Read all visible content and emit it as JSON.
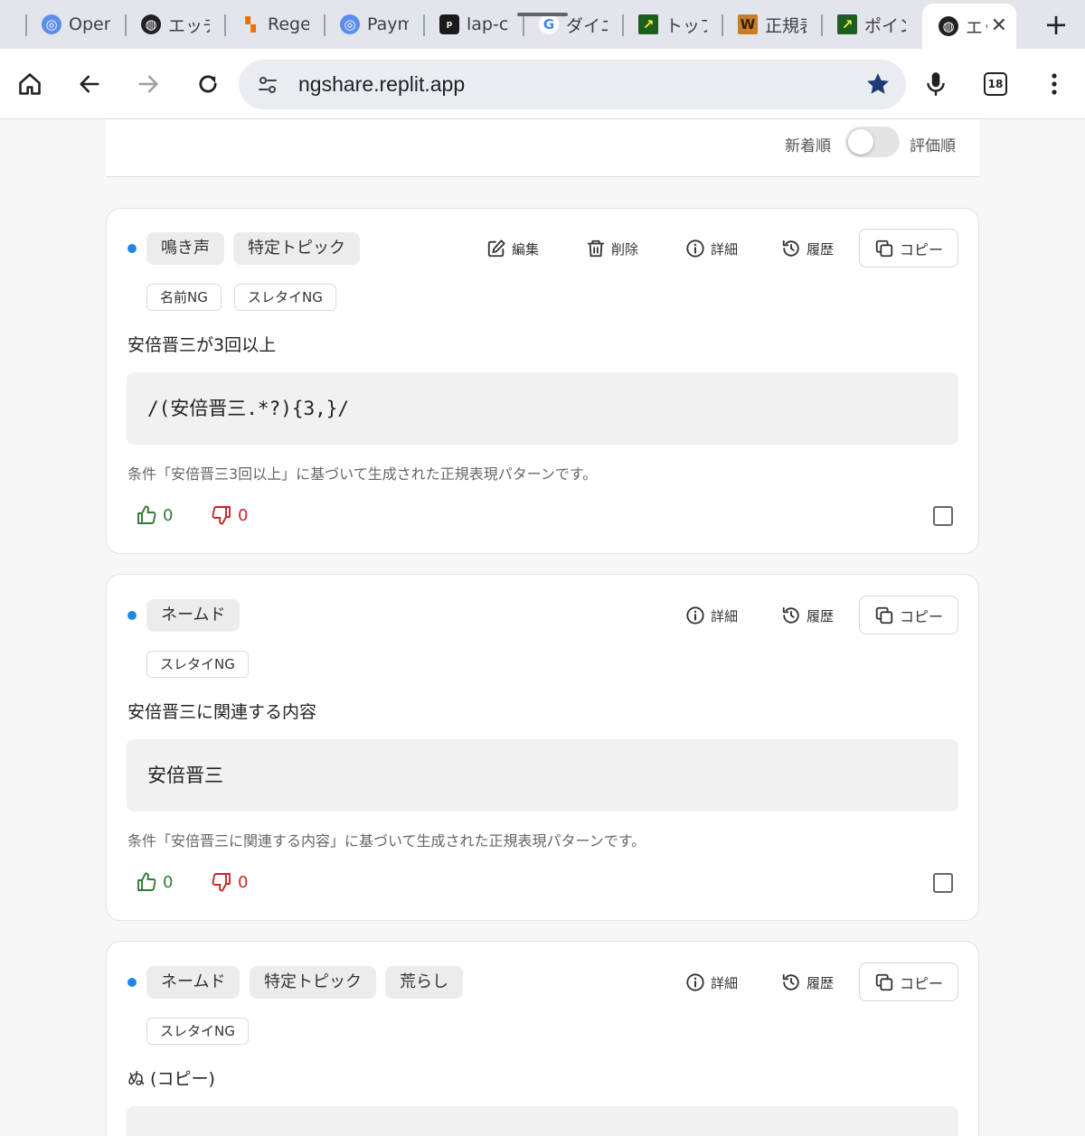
{
  "browser": {
    "tabs": [
      {
        "title": "Open",
        "icon": "openai-icon"
      },
      {
        "title": "エッチ",
        "icon": "globe-icon"
      },
      {
        "title": "Regex",
        "icon": "orange-icon"
      },
      {
        "title": "Paym",
        "icon": "openai-icon"
      },
      {
        "title": "lap-c",
        "icon": "ploom-icon"
      },
      {
        "title": "ダイニ",
        "icon": "google-icon"
      },
      {
        "title": "トップ",
        "icon": "green-icon"
      },
      {
        "title": "正規表",
        "icon": "w-icon"
      },
      {
        "title": "ポイン",
        "icon": "green-icon"
      },
      {
        "title": "エッ",
        "icon": "globe-icon",
        "active": true
      }
    ],
    "url": "ngshare.replit.app",
    "tab_count": "18"
  },
  "sort": {
    "left_label": "新着順",
    "right_label": "評価順"
  },
  "actions": {
    "edit": "編集",
    "delete": "削除",
    "details": "詳細",
    "history": "履歴",
    "copy": "コピー"
  },
  "cards": [
    {
      "tags": [
        "鳴き声",
        "特定トピック"
      ],
      "subtags": [
        "名前NG",
        "スレタイNG"
      ],
      "title": "安倍晋三が3回以上",
      "pattern": "/(安倍晋三.*?){3,}/",
      "note": "条件「安倍晋三3回以上」に基づいて生成された正規表現パターンです。",
      "upvotes": "0",
      "downvotes": "0"
    },
    {
      "tags": [
        "ネームド"
      ],
      "subtags": [
        "スレタイNG"
      ],
      "title": "安倍晋三に関連する内容",
      "pattern": "安倍晋三",
      "note": "条件「安倍晋三に関連する内容」に基づいて生成された正規表現パターンです。",
      "upvotes": "0",
      "downvotes": "0"
    },
    {
      "tags": [
        "ネームド",
        "特定トピック",
        "荒らし"
      ],
      "subtags": [
        "スレタイNG"
      ],
      "title": "ぬ (コピー)"
    }
  ]
}
